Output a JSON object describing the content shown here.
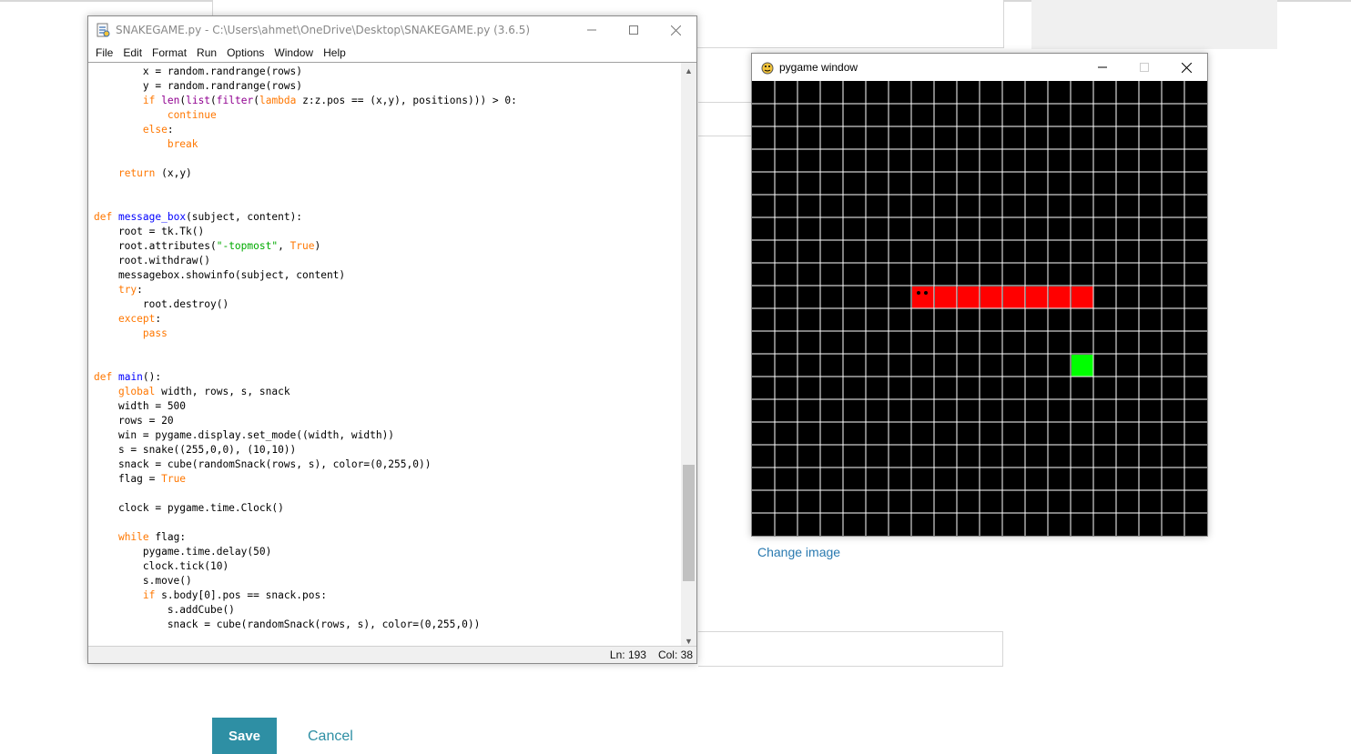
{
  "idle": {
    "title": "SNAKEGAME.py - C:\\Users\\ahmet\\OneDrive\\Desktop\\SNAKEGAME.py (3.6.5)",
    "menu": [
      "File",
      "Edit",
      "Format",
      "Run",
      "Options",
      "Window",
      "Help"
    ],
    "code_lines": [
      [
        [
          "        x = random.randrange(rows)",
          ""
        ]
      ],
      [
        [
          "        y = random.randrange(rows)",
          ""
        ]
      ],
      [
        [
          "        ",
          ""
        ],
        [
          "if",
          "kw"
        ],
        [
          " ",
          ""
        ],
        [
          "len",
          "bi"
        ],
        [
          "(",
          ""
        ],
        [
          "list",
          "bi"
        ],
        [
          "(",
          ""
        ],
        [
          "filter",
          "bi"
        ],
        [
          "(",
          ""
        ],
        [
          "lambda",
          "kw"
        ],
        [
          " z:z.pos == (x,y), positions))) > 0:",
          ""
        ]
      ],
      [
        [
          "            ",
          ""
        ],
        [
          "continue",
          "kw"
        ]
      ],
      [
        [
          "        ",
          ""
        ],
        [
          "else",
          "kw"
        ],
        [
          ":",
          ""
        ]
      ],
      [
        [
          "            ",
          ""
        ],
        [
          "break",
          "kw"
        ]
      ],
      [
        [
          "",
          ""
        ]
      ],
      [
        [
          "    ",
          ""
        ],
        [
          "return",
          "kw"
        ],
        [
          " (x,y)",
          ""
        ]
      ],
      [
        [
          "",
          ""
        ]
      ],
      [
        [
          "",
          ""
        ]
      ],
      [
        [
          "def",
          "kw"
        ],
        [
          " ",
          ""
        ],
        [
          "message_box",
          "fn"
        ],
        [
          "(subject, content):",
          ""
        ]
      ],
      [
        [
          "    root = tk.Tk()",
          ""
        ]
      ],
      [
        [
          "    root.attributes(",
          ""
        ],
        [
          "\"-topmost\"",
          "str"
        ],
        [
          ", ",
          ""
        ],
        [
          "True",
          "kw"
        ],
        [
          ")",
          ""
        ]
      ],
      [
        [
          "    root.withdraw()",
          ""
        ]
      ],
      [
        [
          "    messagebox.showinfo(subject, content)",
          ""
        ]
      ],
      [
        [
          "    ",
          ""
        ],
        [
          "try",
          "kw"
        ],
        [
          ":",
          ""
        ]
      ],
      [
        [
          "        root.destroy()",
          ""
        ]
      ],
      [
        [
          "    ",
          ""
        ],
        [
          "except",
          "kw"
        ],
        [
          ":",
          ""
        ]
      ],
      [
        [
          "        ",
          ""
        ],
        [
          "pass",
          "kw"
        ]
      ],
      [
        [
          "",
          ""
        ]
      ],
      [
        [
          "",
          ""
        ]
      ],
      [
        [
          "def",
          "kw"
        ],
        [
          " ",
          ""
        ],
        [
          "main",
          "fn"
        ],
        [
          "():",
          ""
        ]
      ],
      [
        [
          "    ",
          ""
        ],
        [
          "global",
          "kw"
        ],
        [
          " width, rows, s, snack",
          ""
        ]
      ],
      [
        [
          "    width = 500",
          ""
        ]
      ],
      [
        [
          "    rows = 20",
          ""
        ]
      ],
      [
        [
          "    win = pygame.display.set_mode((width, width))",
          ""
        ]
      ],
      [
        [
          "    s = snake((255,0,0), (10,10))",
          ""
        ]
      ],
      [
        [
          "    snack = cube(randomSnack(rows, s), color=(0,255,0))",
          ""
        ]
      ],
      [
        [
          "    flag = ",
          ""
        ],
        [
          "True",
          "kw"
        ]
      ],
      [
        [
          "",
          ""
        ]
      ],
      [
        [
          "    clock = pygame.time.Clock()",
          ""
        ]
      ],
      [
        [
          "",
          ""
        ]
      ],
      [
        [
          "    ",
          ""
        ],
        [
          "while",
          "kw"
        ],
        [
          " flag:",
          ""
        ]
      ],
      [
        [
          "        pygame.time.delay(50)",
          ""
        ]
      ],
      [
        [
          "        clock.tick(10)",
          ""
        ]
      ],
      [
        [
          "        s.move()",
          ""
        ]
      ],
      [
        [
          "        ",
          ""
        ],
        [
          "if",
          "kw"
        ],
        [
          " s.body[0].pos == snack.pos:",
          ""
        ]
      ],
      [
        [
          "            s.addCube()",
          ""
        ]
      ],
      [
        [
          "            snack = cube(randomSnack(rows, s), color=(0,255,0))",
          ""
        ]
      ]
    ],
    "status": {
      "line": "Ln: 193",
      "col": "Col: 38"
    }
  },
  "pygame": {
    "title": "pygame window",
    "rows": 20,
    "grid_color": "#ffffff",
    "background": "#000000",
    "snake_color": "#ff0000",
    "snack_color": "#00ff00",
    "snake_cells": [
      [
        7,
        9
      ],
      [
        8,
        9
      ],
      [
        9,
        9
      ],
      [
        10,
        9
      ],
      [
        11,
        9
      ],
      [
        12,
        9
      ],
      [
        13,
        9
      ],
      [
        14,
        9
      ]
    ],
    "snack_cell": [
      14,
      12
    ]
  },
  "form": {
    "change_image": "Change image",
    "save": "Save",
    "cancel": "Cancel"
  }
}
